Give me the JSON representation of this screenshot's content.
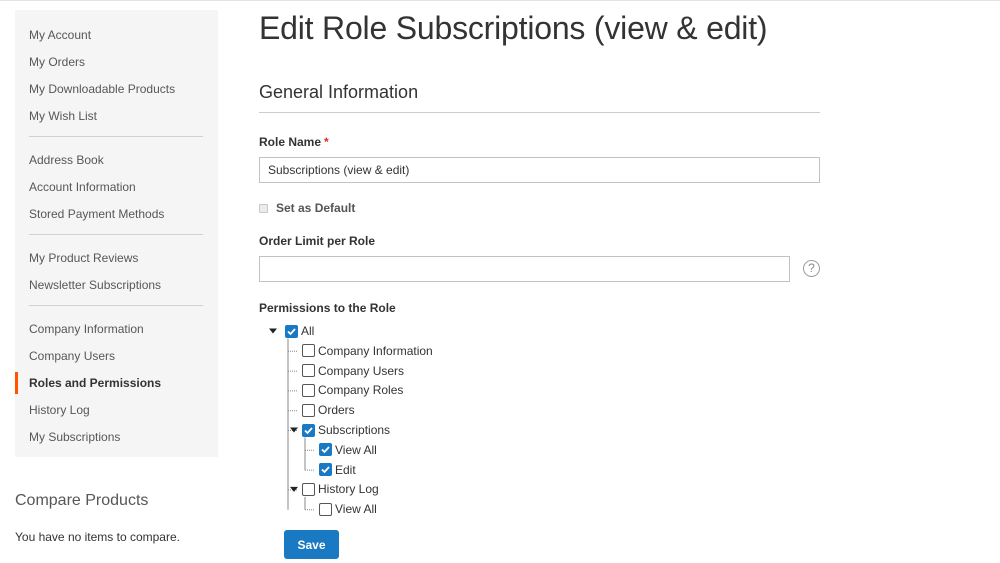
{
  "sidebar": {
    "groups": [
      [
        "My Account",
        "My Orders",
        "My Downloadable Products",
        "My Wish List"
      ],
      [
        "Address Book",
        "Account Information",
        "Stored Payment Methods"
      ],
      [
        "My Product Reviews",
        "Newsletter Subscriptions"
      ],
      [
        "Company Information",
        "Company Users",
        "Roles and Permissions",
        "History Log",
        "My Subscriptions"
      ]
    ],
    "active": "Roles and Permissions"
  },
  "compare": {
    "title": "Compare Products",
    "empty_text": "You have no items to compare."
  },
  "page": {
    "title": "Edit Role Subscriptions (view & edit)"
  },
  "form": {
    "section_title": "General Information",
    "role_name_label": "Role Name",
    "required_mark": "*",
    "role_name_value": "Subscriptions (view & edit)",
    "set_default_label": "Set as Default",
    "order_limit_label": "Order Limit per Role",
    "order_limit_value": "",
    "help_glyph": "?",
    "permissions_label": "Permissions to the Role",
    "save_label": "Save"
  },
  "colors": {
    "accent": "#1979c3",
    "active_marker": "#ff5501",
    "required": "#e02b27"
  },
  "tree": [
    {
      "label": "All",
      "checked": true,
      "expanded": true,
      "children": [
        {
          "label": "Company Information",
          "checked": false,
          "expanded": false
        },
        {
          "label": "Company Users",
          "checked": false,
          "expanded": false
        },
        {
          "label": "Company Roles",
          "checked": false,
          "expanded": false
        },
        {
          "label": "Orders",
          "checked": false,
          "expanded": false
        },
        {
          "label": "Subscriptions",
          "checked": true,
          "expanded": true,
          "children": [
            {
              "label": "View All",
              "checked": true
            },
            {
              "label": "Edit",
              "checked": true
            }
          ]
        },
        {
          "label": "History Log",
          "checked": false,
          "expanded": true,
          "children": [
            {
              "label": "View All",
              "checked": false
            }
          ]
        }
      ]
    }
  ]
}
